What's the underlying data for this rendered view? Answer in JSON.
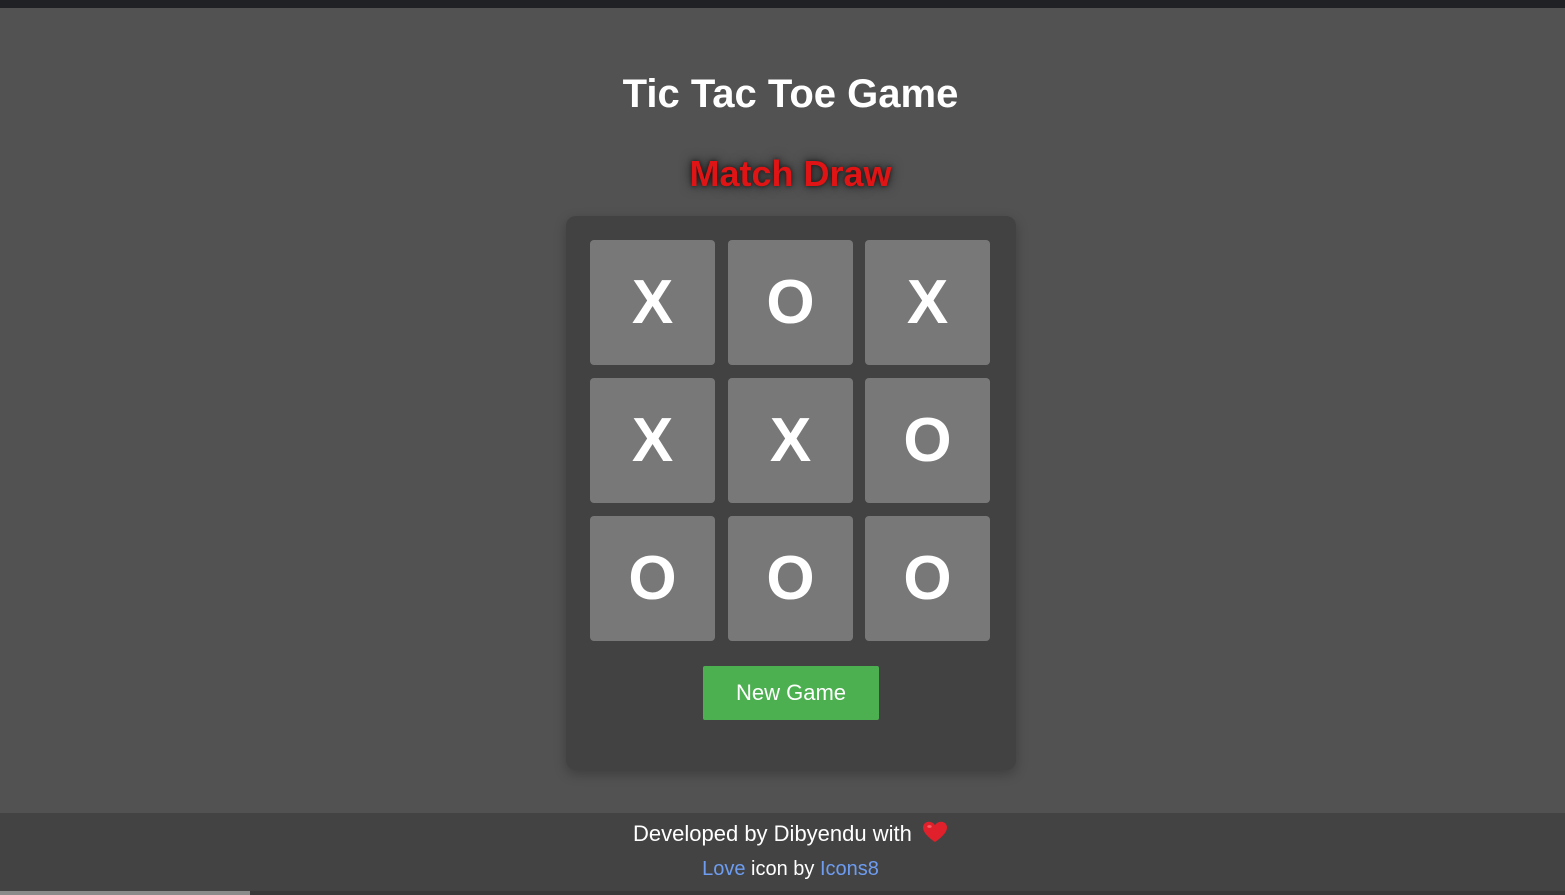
{
  "title": "Tic Tac Toe Game",
  "status": {
    "text": "Match Draw",
    "color": "#e01414"
  },
  "board": {
    "cells": [
      "X",
      "O",
      "X",
      "X",
      "X",
      "O",
      "O",
      "O",
      "O"
    ]
  },
  "new_game_label": "New Game",
  "footer": {
    "developed_text": "Developed by Dibyendu with",
    "heart_icon": "heart-icon",
    "love_link": "Love",
    "icon_by_text": "icon by",
    "icons8_link": "Icons8"
  },
  "colors": {
    "background": "#525252",
    "panel": "#424242",
    "cell": "#787878",
    "button": "#4caf50",
    "link": "#6d9cf0",
    "heart": "#e0202a"
  }
}
